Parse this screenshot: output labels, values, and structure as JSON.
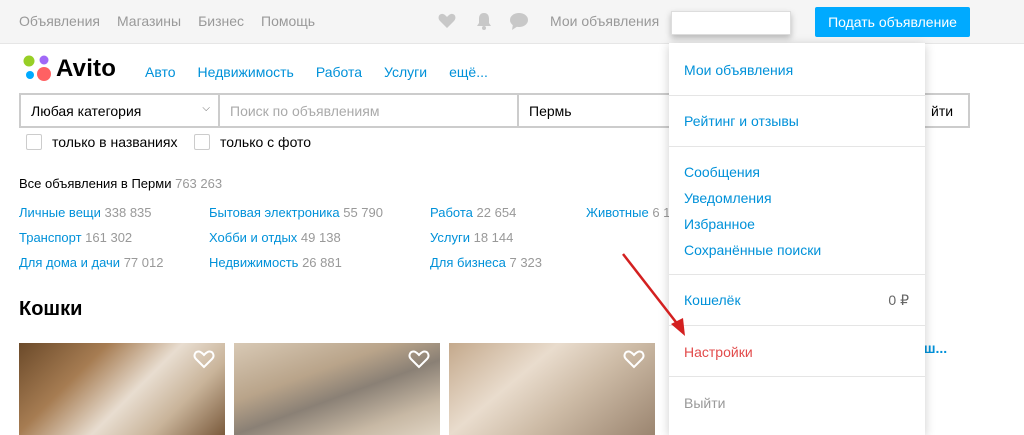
{
  "topbar": {
    "links": [
      "Объявления",
      "Магазины",
      "Бизнес",
      "Помощь"
    ],
    "icons": [
      "heart-icon",
      "bell-icon",
      "chat-icon"
    ],
    "my_ads": "Мои объявления",
    "post_button": "Подать объявление"
  },
  "header": {
    "logo": "Avito",
    "nav": [
      "Авто",
      "Недвижимость",
      "Работа",
      "Услуги",
      "ещё..."
    ]
  },
  "search": {
    "category": "Любая категория",
    "placeholder": "Поиск по объявлениям",
    "city": "Пермь",
    "find": "йти"
  },
  "filters": {
    "names_only": "только в названиях",
    "with_photo": "только с фото"
  },
  "stats": {
    "all_label": "Все объявления в Перми",
    "all_count": "763 263",
    "categories": [
      {
        "label": "Личные вещи",
        "count": "338 835"
      },
      {
        "label": "Транспорт",
        "count": "161 302"
      },
      {
        "label": "Для дома и дачи",
        "count": "77 012"
      },
      {
        "label": "Бытовая электроника",
        "count": "55 790"
      },
      {
        "label": "Хобби и отдых",
        "count": "49 138"
      },
      {
        "label": "Недвижимость",
        "count": "26 881"
      },
      {
        "label": "Работа",
        "count": "22 654"
      },
      {
        "label": "Услуги",
        "count": "18 144"
      },
      {
        "label": "Для бизнеса",
        "count": "7 323"
      },
      {
        "label": "Животные",
        "count": "6 1"
      }
    ]
  },
  "section": {
    "title": "Кошки",
    "show_all": "люш..."
  },
  "menu": {
    "my_ads": "Мои объявления",
    "rating": "Рейтинг и отзывы",
    "messages": "Сообщения",
    "notifications": "Уведомления",
    "favorites": "Избранное",
    "saved_searches": "Сохранённые поиски",
    "wallet": "Кошелёк",
    "wallet_amount": "0 ₽",
    "settings": "Настройки",
    "logout": "Выйти"
  },
  "colors": {
    "accent": "#0091d9",
    "post_button": "#00aaff",
    "settings": "#e24b4b",
    "arrow": "#d32020"
  }
}
